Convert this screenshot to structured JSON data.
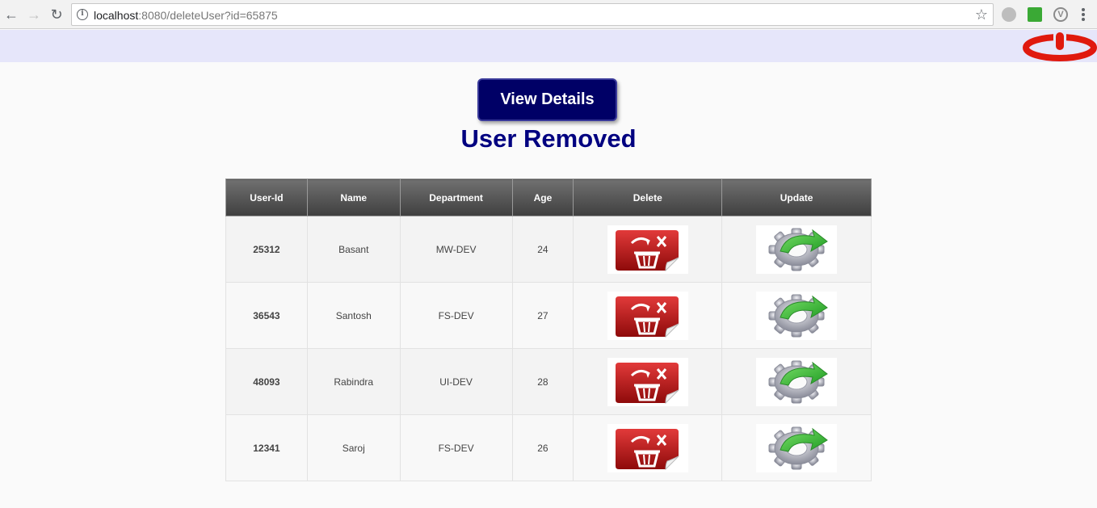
{
  "browser": {
    "url_host": "localhost",
    "url_rest": ":8080/deleteUser?id=65875"
  },
  "main": {
    "view_button_label": "View Details",
    "title": "User Removed"
  },
  "table": {
    "columns": [
      "User-Id",
      "Name",
      "Department",
      "Age",
      "Delete",
      "Update"
    ],
    "rows": [
      {
        "id": "25312",
        "name": "Basant",
        "department": "MW-DEV",
        "age": "24"
      },
      {
        "id": "36543",
        "name": "Santosh",
        "department": "FS-DEV",
        "age": "27"
      },
      {
        "id": "48093",
        "name": "Rabindra",
        "department": "UI-DEV",
        "age": "28"
      },
      {
        "id": "12341",
        "name": "Saroj",
        "department": "FS-DEV",
        "age": "26"
      }
    ]
  },
  "icons": {
    "logout": "power-icon",
    "delete": "trash-icon",
    "update": "gear-refresh-icon"
  },
  "colors": {
    "header_band": "#e6e6fa",
    "button_bg": "#000066",
    "title": "#000080",
    "logout_red": "#e0190e"
  }
}
